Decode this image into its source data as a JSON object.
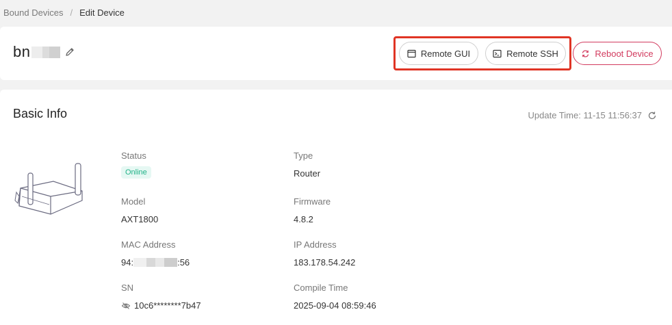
{
  "breadcrumb": {
    "parent": "Bound Devices",
    "separator": "/",
    "current": "Edit Device"
  },
  "device": {
    "name_visible": "bn"
  },
  "actions": {
    "remote_gui": "Remote GUI",
    "remote_ssh": "Remote SSH",
    "reboot": "Reboot Device"
  },
  "basic_info": {
    "title": "Basic Info",
    "update_time_label": "Update Time: 11-15 11:56:37",
    "fields": {
      "status": {
        "label": "Status",
        "value": "Online"
      },
      "type": {
        "label": "Type",
        "value": "Router"
      },
      "model": {
        "label": "Model",
        "value": "AXT1800"
      },
      "firmware": {
        "label": "Firmware",
        "value": "4.8.2"
      },
      "mac": {
        "label": "MAC Address",
        "prefix": "94:",
        "suffix": ":56"
      },
      "ip": {
        "label": "IP Address",
        "value": "183.178.54.242"
      },
      "sn": {
        "label": "SN",
        "value": "10c6********7b47"
      },
      "compile_time": {
        "label": "Compile Time",
        "value": "2025-09-04 08:59:46"
      }
    }
  },
  "colors": {
    "highlight": "#e03424",
    "reboot_accent": "#d23a5e",
    "online_text": "#20b287",
    "online_bg": "#e6f8f3"
  },
  "icons": {
    "edit": "pencil-icon",
    "gui": "window-icon",
    "ssh": "terminal-icon",
    "reboot": "refresh-arrows-icon",
    "update": "refresh-icon",
    "sn": "eye-slash-icon"
  }
}
